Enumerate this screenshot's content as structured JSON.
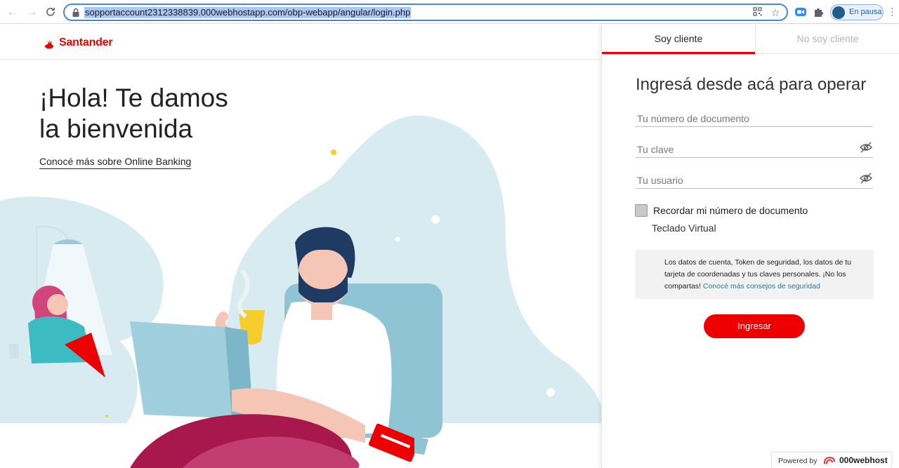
{
  "browser": {
    "url": "sopportaccount2312338839.000webhostapp.com/obp-webapp/angular/login.php",
    "back_icon": "arrow-left-icon",
    "forward_icon": "arrow-right-icon",
    "reload_icon": "reload-icon",
    "profile_status": "En pausa"
  },
  "header": {
    "logo_text": "Santander"
  },
  "hero": {
    "title_line1": "¡Hola! Te damos",
    "title_line2": "la bienvenida",
    "link": "Conocé más sobre Online Banking"
  },
  "panel": {
    "tabs": [
      {
        "label": "Soy cliente",
        "active": true
      },
      {
        "label": "No soy cliente",
        "active": false
      }
    ],
    "title": "Ingresá desde acá para operar",
    "fields": {
      "documento_placeholder": "Tu número de documento",
      "clave_placeholder": "Tu clave",
      "usuario_placeholder": "Tu usuario"
    },
    "remember_label": "Recordar mi número de documento",
    "teclado_label": "Teclado Virtual",
    "notice_text": "Los datos de cuenta, Token de seguridad, los datos de tu tarjeta de coordenadas y tus claves personales. ¡No los compartas!",
    "notice_link": "Conocé más consejos de seguridad",
    "submit_label": "Ingresar"
  },
  "footer": {
    "powered_by": "Powered by",
    "powered_brand": "000webhost"
  },
  "colors": {
    "brand_red": "#ec0000",
    "illustration_blue": "#d7ebf0"
  }
}
